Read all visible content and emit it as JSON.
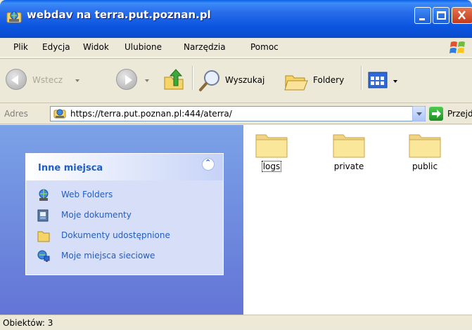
{
  "window": {
    "title": "webdav na terra.put.poznan.pl",
    "title_icon": "web-folder-icon"
  },
  "menu": {
    "items": [
      "Plik",
      "Edycja",
      "Widok",
      "Ulubione",
      "Narzędzia",
      "Pomoc"
    ]
  },
  "toolbar": {
    "back_label": "Wstecz",
    "search_label": "Wyszukaj",
    "folders_label": "Foldery"
  },
  "address": {
    "label": "Adres",
    "url": "https://terra.put.poznan.pl:444/aterra/",
    "go_label": "Przejdź"
  },
  "other_places": {
    "title": "Inne miejsca",
    "items": [
      {
        "label": "Web Folders",
        "icon": "web-folders-icon"
      },
      {
        "label": "Moje dokumenty",
        "icon": "my-documents-icon"
      },
      {
        "label": "Dokumenty udostępnione",
        "icon": "shared-documents-icon"
      },
      {
        "label": "Moje miejsca sieciowe",
        "icon": "network-places-icon"
      }
    ]
  },
  "files": [
    {
      "name": "logs",
      "focused": true
    },
    {
      "name": "private",
      "focused": false
    },
    {
      "name": "public",
      "focused": false
    }
  ],
  "status": {
    "text": "Obiektów: 3"
  },
  "colors": {
    "title_bar": "#0A55DF",
    "panel_title": "#215DC6",
    "left_pane_top": "#7BA2E7",
    "left_pane_bottom": "#6375D6",
    "folder_fill": "#FBE79A"
  }
}
